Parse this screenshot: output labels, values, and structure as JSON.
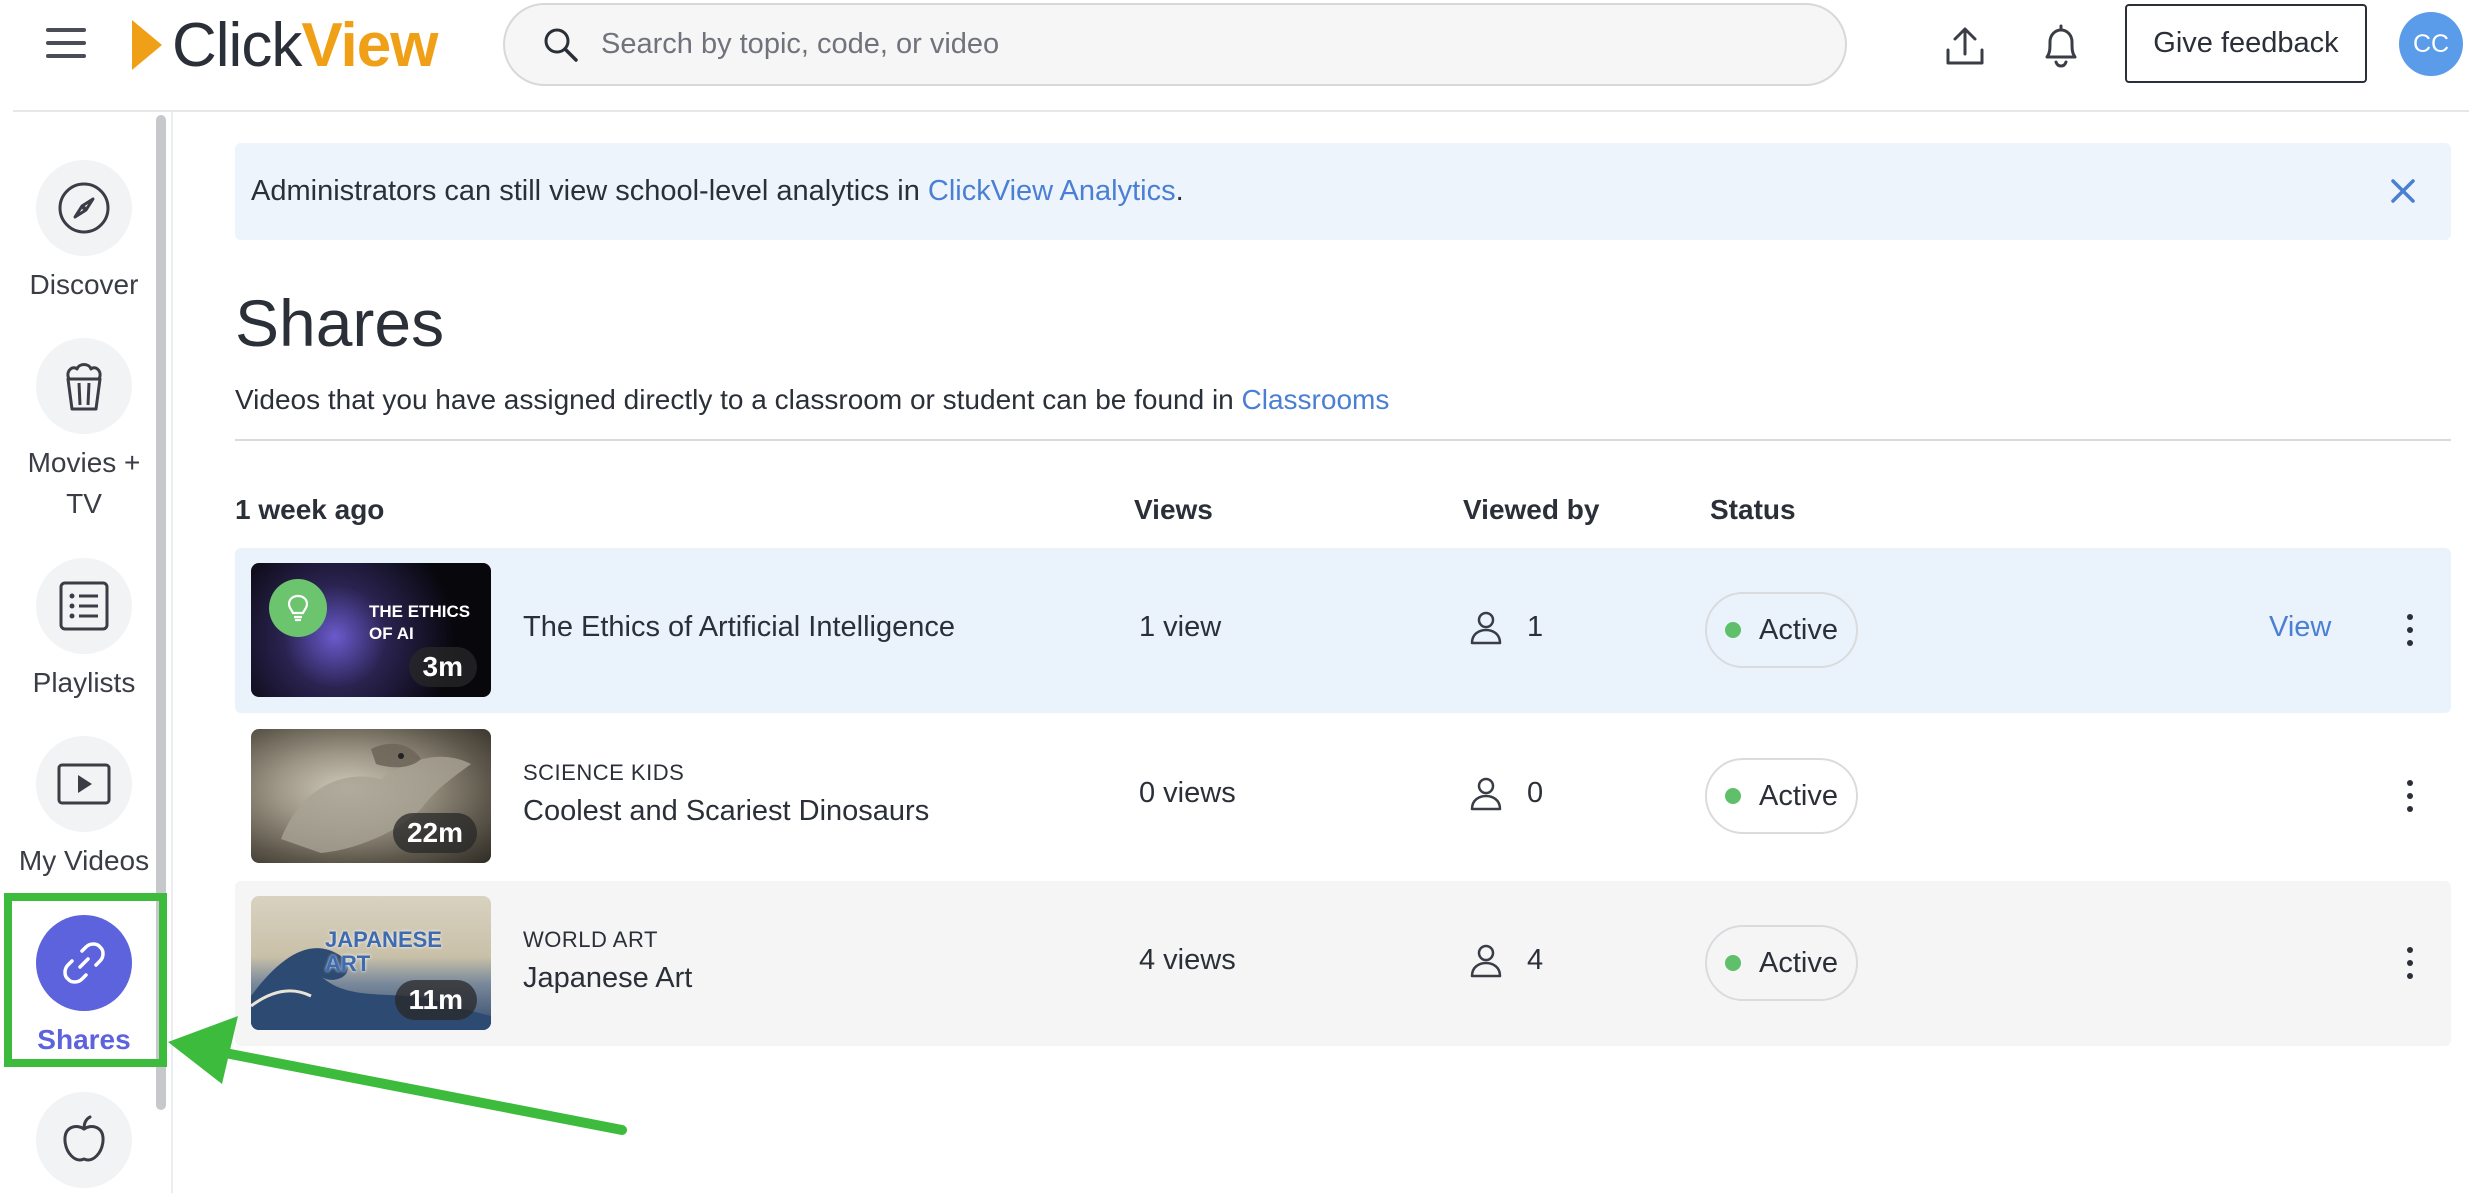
{
  "header": {
    "logo_click": "Click",
    "logo_view": "View",
    "search_placeholder": "Search by topic, code, or video",
    "feedback_label": "Give feedback",
    "avatar_initials": "CC"
  },
  "sidebar": {
    "items": [
      {
        "label": "Discover",
        "icon": "compass-icon"
      },
      {
        "label": "Movies + TV",
        "icon": "popcorn-icon"
      },
      {
        "label": "Playlists",
        "icon": "list-icon"
      },
      {
        "label": "My Videos",
        "icon": "play-icon"
      },
      {
        "label": "Shares",
        "icon": "link-icon",
        "active": true
      },
      {
        "label": "",
        "icon": "apple-icon"
      }
    ]
  },
  "banner": {
    "text": "Administrators can still view school-level analytics in ",
    "link": "ClickView Analytics",
    "suffix": "."
  },
  "page": {
    "title": "Shares",
    "subtitle": "Videos that you have assigned directly to a classroom or student can be found in ",
    "subtitle_link": "Classrooms"
  },
  "table": {
    "headers": {
      "group": "1 week ago",
      "views": "Views",
      "viewed_by": "Viewed by",
      "status": "Status"
    },
    "rows": [
      {
        "series": "",
        "title": "The Ethics of Artificial Intelligence",
        "duration": "3m",
        "thumb_text": "THE ETHICS OF AI",
        "views": "1 view",
        "viewed_by": "1",
        "status": "Active",
        "action": "View"
      },
      {
        "series": "SCIENCE KIDS",
        "title": "Coolest and Scariest Dinosaurs",
        "duration": "22m",
        "thumb_text": "",
        "views": "0 views",
        "viewed_by": "0",
        "status": "Active",
        "action": ""
      },
      {
        "series": "WORLD ART",
        "title": "Japanese Art",
        "duration": "11m",
        "thumb_text": "JAPANESE ART",
        "views": "4 views",
        "viewed_by": "4",
        "status": "Active",
        "action": ""
      }
    ]
  },
  "colors": {
    "brand_orange": "#f0a017",
    "accent_purple": "#5c63dc",
    "link_blue": "#4a7fd4",
    "status_green": "#5fbf6a",
    "annotation_green": "#3dbb3d"
  }
}
